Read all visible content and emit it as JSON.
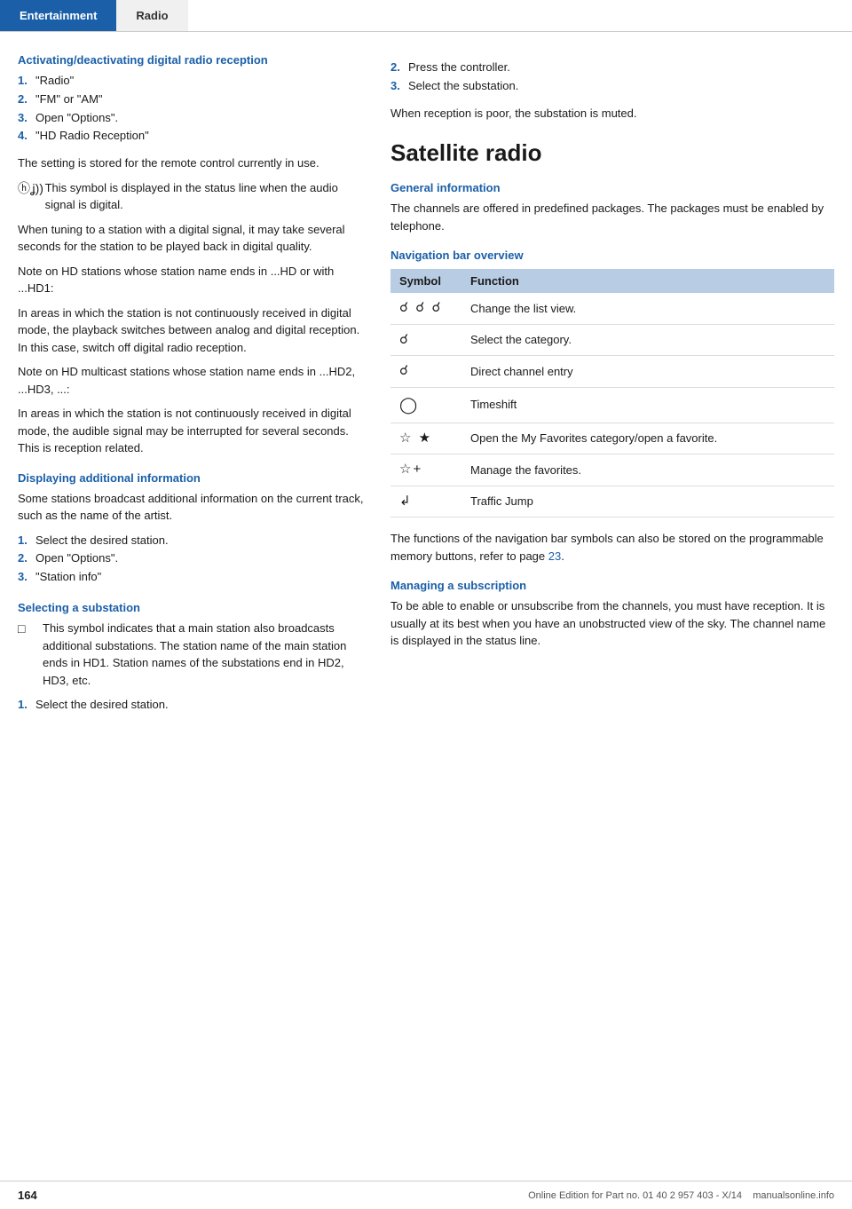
{
  "nav": {
    "tab1": "Entertainment",
    "tab2": "Radio"
  },
  "left": {
    "section1_title": "Activating/deactivating digital radio reception",
    "steps1": [
      {
        "num": "1.",
        "text": "\"Radio\""
      },
      {
        "num": "2.",
        "text": "\"FM\" or \"AM\""
      },
      {
        "num": "3.",
        "text": "Open \"Options\"."
      },
      {
        "num": "4.",
        "text": "\"HD Radio Reception\""
      }
    ],
    "para1": "The setting is stored for the remote control currently in use.",
    "symbol_note": "This symbol is displayed in the status line when the audio signal is digital.",
    "para2": "When tuning to a station with a digital signal, it may take several seconds for the station to be played back in digital quality.",
    "para3": "Note on HD stations whose station name ends in ...HD or with ...HD1:",
    "para4": "In areas in which the station is not continuously received in digital mode, the playback switches between analog and digital reception. In this case, switch off digital radio reception.",
    "para5": "Note on HD multicast stations whose station name ends in ...HD2, ...HD3, ...:",
    "para6": "In areas in which the station is not continuously received in digital mode, the audible signal may be interrupted for several seconds. This is reception related.",
    "section2_title": "Displaying additional information",
    "para7": "Some stations broadcast additional information on the current track, such as the name of the artist.",
    "steps2": [
      {
        "num": "1.",
        "text": "Select the desired station."
      },
      {
        "num": "2.",
        "text": "Open \"Options\"."
      },
      {
        "num": "3.",
        "text": "\"Station info\""
      }
    ],
    "section3_title": "Selecting a substation",
    "symbol_note2": "This symbol indicates that a main station also broadcasts additional substations. The station name of the main station ends in HD1. Station names of the substations end in HD2, HD3, etc.",
    "steps3": [
      {
        "num": "1.",
        "text": "Select the desired station."
      }
    ]
  },
  "right": {
    "steps_continued": [
      {
        "num": "2.",
        "text": "Press the controller."
      },
      {
        "num": "3.",
        "text": "Select the substation."
      }
    ],
    "para_muted": "When reception is poor, the substation is muted.",
    "big_title": "Satellite radio",
    "section_general": "General information",
    "para_general": "The channels are offered in predefined packages. The packages must be enabled by telephone.",
    "section_navbar": "Navigation bar overview",
    "table_headers": [
      "Symbol",
      "Function"
    ],
    "table_rows": [
      {
        "symbols": "⟳  ⟳  ⟳",
        "function": "Change the list view."
      },
      {
        "symbols": "⟳",
        "function": "Select the category."
      },
      {
        "symbols": "⟳",
        "function": "Direct channel entry"
      },
      {
        "symbols": "⏻",
        "function": "Timeshift"
      },
      {
        "symbols": "☆  ☆★",
        "function": "Open the My Favorites category/open a favorite."
      },
      {
        "symbols": "☆+",
        "function": "Manage the favorites."
      },
      {
        "symbols": "↩",
        "function": "Traffic Jump"
      }
    ],
    "para_nav_functions": "The functions of the navigation bar symbols can also be stored on the programmable memory buttons, refer to page ",
    "nav_page_ref": "23",
    "section_subscription": "Managing a subscription",
    "para_subscription": "To be able to enable or unsubscribe from the channels, you must have reception. It is usually at its best when you have an unobstructed view of the sky. The channel name is displayed in the status line."
  },
  "footer": {
    "page_num": "164",
    "edition_text": "Online Edition for Part no. 01 40 2 957 403 - X/14",
    "site": "manualsonline.info"
  }
}
